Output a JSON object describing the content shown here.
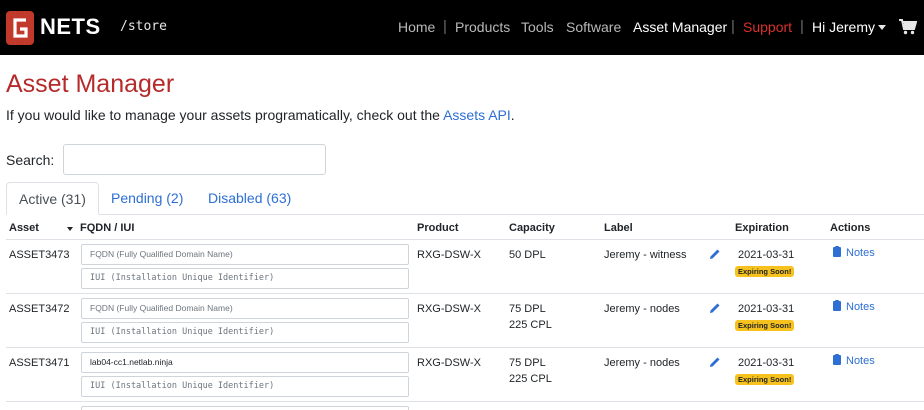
{
  "navbar": {
    "brand": "NETS",
    "store": "/store",
    "items": [
      {
        "label": "Home"
      },
      {
        "label": "Products"
      },
      {
        "label": "Tools"
      },
      {
        "label": "Software"
      },
      {
        "label": "Asset Manager"
      },
      {
        "label": "Support"
      },
      {
        "label": "Hi Jeremy"
      }
    ],
    "colors": {
      "background": "#000000",
      "support": "#d9302c",
      "active": "#ffffff"
    }
  },
  "page": {
    "title": "Asset Manager",
    "intro_text": "If you would like to manage your assets programatically, check out the ",
    "intro_link": "Assets API",
    "intro_end": ".",
    "search_label": "Search:",
    "search_value": ""
  },
  "tabs": [
    {
      "label": "Active (31)"
    },
    {
      "label": "Pending (2)"
    },
    {
      "label": "Disabled (63)"
    }
  ],
  "table": {
    "headers": {
      "asset": "Asset",
      "fqdn": "FQDN / IUI",
      "product": "Product",
      "capacity": "Capacity",
      "label": "Label",
      "expiration": "Expiration",
      "actions": "Actions"
    },
    "rows": [
      {
        "asset": "ASSET3473",
        "fqdn": "",
        "fqdn_placeholder": "FQDN (Fully Qualified Domain Name)",
        "iui": "",
        "iui_placeholder": "IUI (Installation Unique Identifier)",
        "product": "RXG-DSW-X",
        "capacity_1": "50 DPL",
        "capacity_2": "",
        "label": "Jeremy - witness",
        "expiration": "2021-03-31",
        "badge": "Expiring Soon!",
        "notes": "Notes"
      },
      {
        "asset": "ASSET3472",
        "fqdn": "",
        "fqdn_placeholder": "FQDN (Fully Qualified Domain Name)",
        "iui": "",
        "iui_placeholder": "IUI (Installation Unique Identifier)",
        "product": "RXG-DSW-X",
        "capacity_1": "75 DPL",
        "capacity_2": "225 CPL",
        "label": "Jeremy - nodes",
        "expiration": "2021-03-31",
        "badge": "Expiring Soon!",
        "notes": "Notes"
      },
      {
        "asset": "ASSET3471",
        "fqdn": "lab04-cc1.netlab.ninja",
        "fqdn_placeholder": "FQDN (Fully Qualified Domain Name)",
        "iui": "",
        "iui_placeholder": "IUI (Installation Unique Identifier)",
        "product": "RXG-DSW-X",
        "capacity_1": "75 DPL",
        "capacity_2": "225 CPL",
        "label": "Jeremy - nodes",
        "expiration": "2021-03-31",
        "badge": "Expiring Soon!",
        "notes": "Notes"
      }
    ]
  },
  "icons": {
    "logo": "brand-logo-icon",
    "caret": "chevron-down-icon",
    "cart": "shopping-cart-icon",
    "edit": "pencil-icon",
    "notes": "clipboard-icon"
  }
}
